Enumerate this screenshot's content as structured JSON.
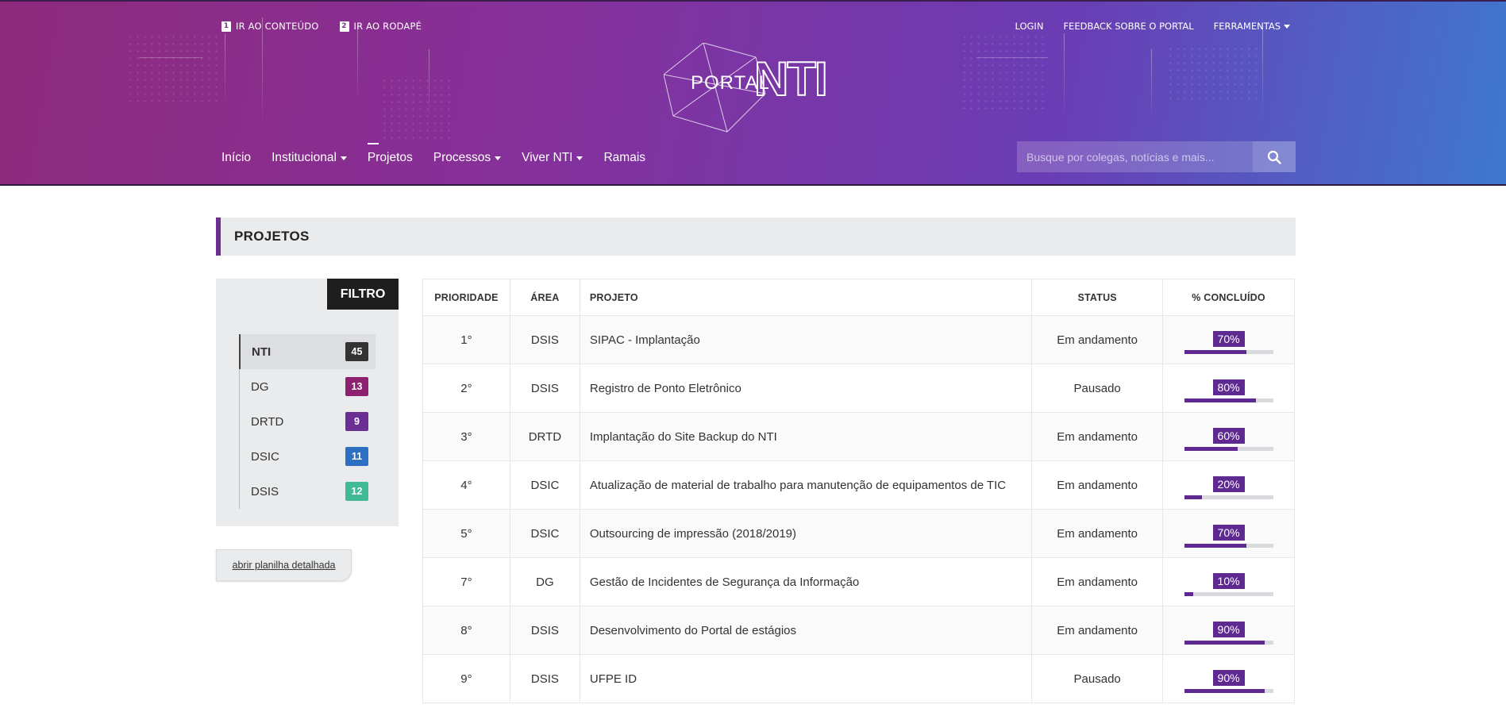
{
  "header": {
    "skip_links": [
      {
        "key": "1",
        "label": "IR AO CONTEÚDO"
      },
      {
        "key": "2",
        "label": "IR AO RODAPÉ"
      }
    ],
    "top_menu": {
      "login": "LOGIN",
      "feedback": "FEEDBACK SOBRE O PORTAL",
      "tools": "FERRAMENTAS"
    },
    "logo": {
      "small": "PORTAL",
      "big": "NTI"
    },
    "nav": [
      {
        "label": "Início",
        "dropdown": false
      },
      {
        "label": "Institucional",
        "dropdown": true
      },
      {
        "label": "Projetos",
        "dropdown": false,
        "active": true
      },
      {
        "label": "Processos",
        "dropdown": true
      },
      {
        "label": "Viver NTI",
        "dropdown": true
      },
      {
        "label": "Ramais",
        "dropdown": false
      }
    ],
    "search": {
      "placeholder": "Busque por colegas, notícias e mais..."
    }
  },
  "page": {
    "title": "PROJETOS"
  },
  "filter": {
    "title": "FILTRO",
    "items": [
      {
        "label": "NTI",
        "count": "45",
        "color": "#333333"
      },
      {
        "label": "DG",
        "count": "13",
        "color": "#8e2070"
      },
      {
        "label": "DRTD",
        "count": "9",
        "color": "#6b2f94"
      },
      {
        "label": "DSIC",
        "count": "11",
        "color": "#2d6fc0"
      },
      {
        "label": "DSIS",
        "count": "12",
        "color": "#3fba94"
      }
    ],
    "sheet_button": "abrir planilha detalhada"
  },
  "table": {
    "headers": [
      "PRIORIDADE",
      "ÁREA",
      "PROJETO",
      "STATUS",
      "% CONCLUÍDO"
    ],
    "rows": [
      {
        "priority": "1°",
        "area": "DSIS",
        "project": "SIPAC - Implantação",
        "status": "Em andamento",
        "percent_label": "70%",
        "percent": 70
      },
      {
        "priority": "2°",
        "area": "DSIS",
        "project": "Registro de Ponto Eletrônico",
        "status": "Pausado",
        "percent_label": "80%",
        "percent": 80
      },
      {
        "priority": "3°",
        "area": "DRTD",
        "project": "Implantação do Site Backup do NTI",
        "status": "Em andamento",
        "percent_label": "60%",
        "percent": 60
      },
      {
        "priority": "4°",
        "area": "DSIC",
        "project": "Atualização de material de trabalho para manutenção de equipamentos de TIC",
        "status": "Em andamento",
        "percent_label": "20%",
        "percent": 20
      },
      {
        "priority": "5°",
        "area": "DSIC",
        "project": "Outsourcing de impressão (2018/2019)",
        "status": "Em andamento",
        "percent_label": "70%",
        "percent": 70
      },
      {
        "priority": "7°",
        "area": "DG",
        "project": "Gestão de Incidentes de Segurança da Informação",
        "status": "Em andamento",
        "percent_label": "10%",
        "percent": 10
      },
      {
        "priority": "8°",
        "area": "DSIS",
        "project": "Desenvolvimento do Portal de estágios",
        "status": "Em andamento",
        "percent_label": "90%",
        "percent": 90
      },
      {
        "priority": "9°",
        "area": "DSIS",
        "project": "UFPE ID",
        "status": "Pausado",
        "percent_label": "90%",
        "percent": 90
      }
    ]
  },
  "colors": {
    "accent": "#5e2a91",
    "header_start": "#8e2a7c",
    "header_end": "#3e78cf"
  }
}
